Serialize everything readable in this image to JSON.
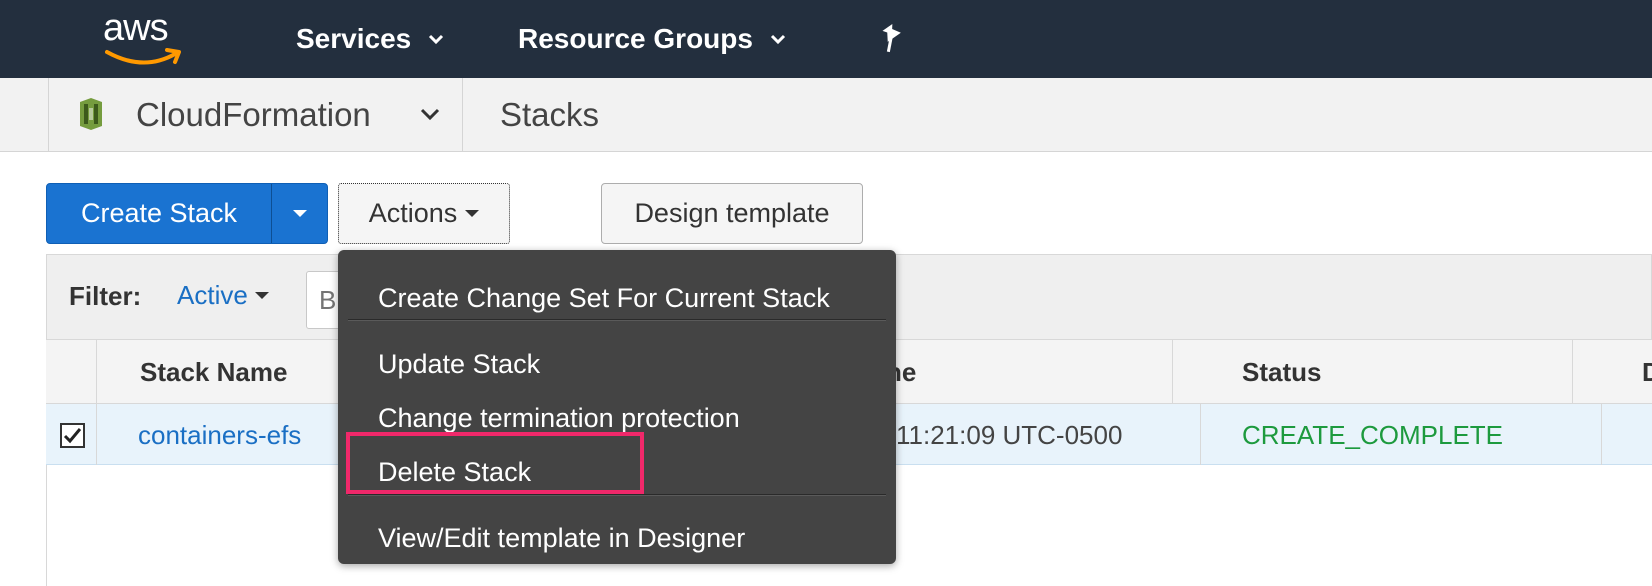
{
  "topnav": {
    "logo_text": "aws",
    "services_label": "Services",
    "resource_groups_label": "Resource Groups",
    "pin_icon": "pushpin-icon"
  },
  "subbar": {
    "service_label": "CloudFormation",
    "page_label": "Stacks"
  },
  "toolbar": {
    "create_label": "Create Stack",
    "actions_label": "Actions",
    "design_label": "Design template"
  },
  "filter": {
    "label": "Filter:",
    "active_label": "Active",
    "input_placeholder": "B"
  },
  "table": {
    "headers": [
      "Stack Name",
      "ne",
      "Status",
      "D"
    ],
    "rows": [
      {
        "name": "containers-efs",
        "time": "11:21:09 UTC-0500",
        "status": "CREATE_COMPLETE",
        "checked": true
      }
    ]
  },
  "menu": {
    "items": [
      "Create Change Set For Current Stack",
      "Update Stack",
      "Change termination protection",
      "Delete Stack",
      "View/Edit template in Designer"
    ],
    "highlighted": "Delete Stack"
  },
  "colors": {
    "nav_bg": "#232f3e",
    "primary": "#1a73d1",
    "link": "#1a6fc4",
    "status_ok": "#1d9a3e",
    "menu_bg": "#444444",
    "highlight": "#f0286a"
  }
}
